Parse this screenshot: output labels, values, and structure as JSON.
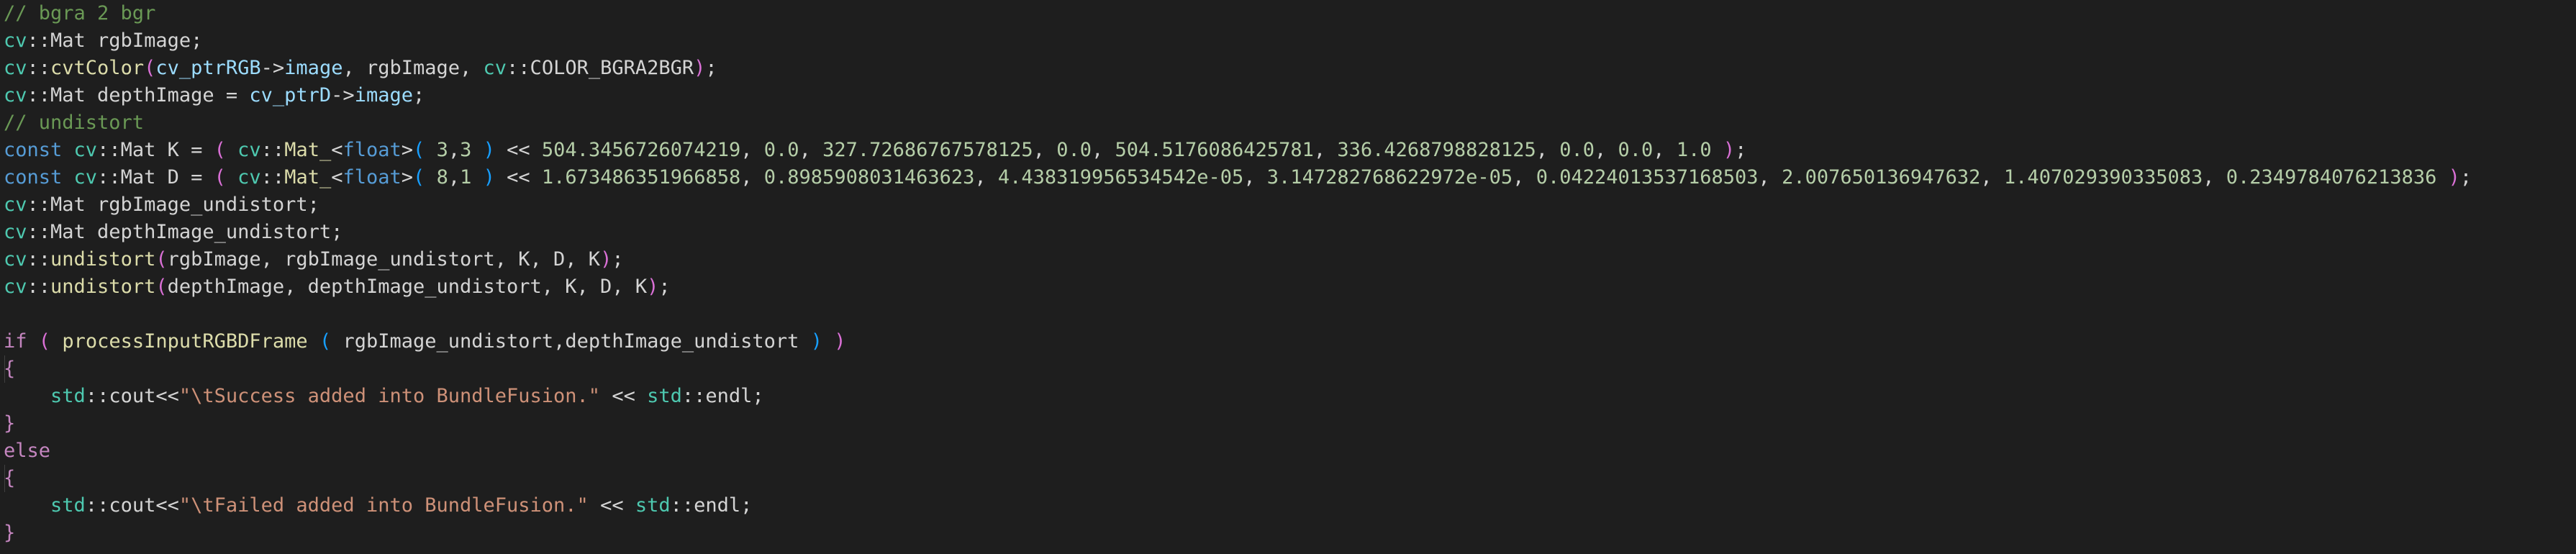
{
  "editor": {
    "lines": [
      [
        [
          "comment",
          "// bgra 2 bgr"
        ]
      ],
      [
        [
          "ns",
          "cv"
        ],
        [
          "plain",
          "::Mat rgbImage;"
        ]
      ],
      [
        [
          "ns",
          "cv"
        ],
        [
          "plain",
          "::"
        ],
        [
          "func",
          "cvtColor"
        ],
        [
          "paren1",
          "("
        ],
        [
          "ident",
          "cv_ptrRGB"
        ],
        [
          "plain",
          "->"
        ],
        [
          "ident",
          "image"
        ],
        [
          "plain",
          ", rgbImage, "
        ],
        [
          "ns",
          "cv"
        ],
        [
          "plain",
          "::COLOR_BGRA2BGR"
        ],
        [
          "paren1",
          ")"
        ],
        [
          "plain",
          ";"
        ]
      ],
      [
        [
          "ns",
          "cv"
        ],
        [
          "plain",
          "::Mat depthImage = "
        ],
        [
          "ident",
          "cv_ptrD"
        ],
        [
          "plain",
          "->"
        ],
        [
          "ident",
          "image"
        ],
        [
          "plain",
          ";"
        ]
      ],
      [
        [
          "comment",
          "// undistort"
        ]
      ],
      [
        [
          "keyword",
          "const"
        ],
        [
          "plain",
          " "
        ],
        [
          "ns",
          "cv"
        ],
        [
          "plain",
          "::Mat K = "
        ],
        [
          "paren1",
          "("
        ],
        [
          "plain",
          " "
        ],
        [
          "ns",
          "cv"
        ],
        [
          "plain",
          "::"
        ],
        [
          "func",
          "Mat_"
        ],
        [
          "plain",
          "<"
        ],
        [
          "keyword",
          "float"
        ],
        [
          "plain",
          ">"
        ],
        [
          "paren2",
          "("
        ],
        [
          "plain",
          " "
        ],
        [
          "number",
          "3"
        ],
        [
          "plain",
          ","
        ],
        [
          "number",
          "3"
        ],
        [
          "plain",
          " "
        ],
        [
          "paren2",
          ")"
        ],
        [
          "plain",
          " << "
        ],
        [
          "number",
          "504.3456726074219"
        ],
        [
          "plain",
          ", "
        ],
        [
          "number",
          "0.0"
        ],
        [
          "plain",
          ", "
        ],
        [
          "number",
          "327.72686767578125"
        ],
        [
          "plain",
          ", "
        ],
        [
          "number",
          "0.0"
        ],
        [
          "plain",
          ", "
        ],
        [
          "number",
          "504.5176086425781"
        ],
        [
          "plain",
          ", "
        ],
        [
          "number",
          "336.4268798828125"
        ],
        [
          "plain",
          ", "
        ],
        [
          "number",
          "0.0"
        ],
        [
          "plain",
          ", "
        ],
        [
          "number",
          "0.0"
        ],
        [
          "plain",
          ", "
        ],
        [
          "number",
          "1.0"
        ],
        [
          "plain",
          " "
        ],
        [
          "paren1",
          ")"
        ],
        [
          "plain",
          ";"
        ]
      ],
      [
        [
          "keyword",
          "const"
        ],
        [
          "plain",
          " "
        ],
        [
          "ns",
          "cv"
        ],
        [
          "plain",
          "::Mat D = "
        ],
        [
          "paren1",
          "("
        ],
        [
          "plain",
          " "
        ],
        [
          "ns",
          "cv"
        ],
        [
          "plain",
          "::"
        ],
        [
          "func",
          "Mat_"
        ],
        [
          "plain",
          "<"
        ],
        [
          "keyword",
          "float"
        ],
        [
          "plain",
          ">"
        ],
        [
          "paren2",
          "("
        ],
        [
          "plain",
          " "
        ],
        [
          "number",
          "8"
        ],
        [
          "plain",
          ","
        ],
        [
          "number",
          "1"
        ],
        [
          "plain",
          " "
        ],
        [
          "paren2",
          ")"
        ],
        [
          "plain",
          " << "
        ],
        [
          "number",
          "1.673486351966858"
        ],
        [
          "plain",
          ", "
        ],
        [
          "number",
          "0.8985908031463623"
        ],
        [
          "plain",
          ", "
        ],
        [
          "number",
          "4.438319956534542e-05"
        ],
        [
          "plain",
          ", "
        ],
        [
          "number",
          "3.147282768622972e-05"
        ],
        [
          "plain",
          ", "
        ],
        [
          "number",
          "0.04224013537168503"
        ],
        [
          "plain",
          ", "
        ],
        [
          "number",
          "2.007650136947632"
        ],
        [
          "plain",
          ", "
        ],
        [
          "number",
          "1.407029390335083"
        ],
        [
          "plain",
          ", "
        ],
        [
          "number",
          "0.2349784076213836"
        ],
        [
          "plain",
          " "
        ],
        [
          "paren1",
          ")"
        ],
        [
          "plain",
          ";"
        ]
      ],
      [
        [
          "ns",
          "cv"
        ],
        [
          "plain",
          "::Mat rgbImage_undistort;"
        ]
      ],
      [
        [
          "ns",
          "cv"
        ],
        [
          "plain",
          "::Mat depthImage_undistort;"
        ]
      ],
      [
        [
          "ns",
          "cv"
        ],
        [
          "plain",
          "::"
        ],
        [
          "func",
          "undistort"
        ],
        [
          "paren1",
          "("
        ],
        [
          "plain",
          "rgbImage, rgbImage_undistort, K, D, K"
        ],
        [
          "paren1",
          ")"
        ],
        [
          "plain",
          ";"
        ]
      ],
      [
        [
          "ns",
          "cv"
        ],
        [
          "plain",
          "::"
        ],
        [
          "func",
          "undistort"
        ],
        [
          "paren1",
          "("
        ],
        [
          "plain",
          "depthImage, depthImage_undistort, K, D, K"
        ],
        [
          "paren1",
          ")"
        ],
        [
          "plain",
          ";"
        ]
      ],
      [],
      [
        [
          "control",
          "if"
        ],
        [
          "plain",
          " "
        ],
        [
          "paren1",
          "("
        ],
        [
          "plain",
          " "
        ],
        [
          "func",
          "processInputRGBDFrame"
        ],
        [
          "plain",
          " "
        ],
        [
          "paren2",
          "("
        ],
        [
          "plain",
          " rgbImage_undistort,depthImage_undistort "
        ],
        [
          "paren2",
          ")"
        ],
        [
          "plain",
          " "
        ],
        [
          "paren1",
          ")"
        ]
      ],
      [
        [
          "brace",
          "{"
        ]
      ],
      [
        [
          "plain",
          "    "
        ],
        [
          "ns",
          "std"
        ],
        [
          "plain",
          "::cout<<"
        ],
        [
          "string",
          "\"\\tSuccess added into BundleFusion.\""
        ],
        [
          "plain",
          " << "
        ],
        [
          "ns",
          "std"
        ],
        [
          "plain",
          "::endl;"
        ]
      ],
      [
        [
          "brace",
          "}"
        ]
      ],
      [
        [
          "control",
          "else"
        ]
      ],
      [
        [
          "brace",
          "{"
        ]
      ],
      [
        [
          "plain",
          "    "
        ],
        [
          "ns",
          "std"
        ],
        [
          "plain",
          "::cout<<"
        ],
        [
          "string",
          "\"\\tFailed added into BundleFusion.\""
        ],
        [
          "plain",
          " << "
        ],
        [
          "ns",
          "std"
        ],
        [
          "plain",
          "::endl;"
        ]
      ],
      [
        [
          "brace",
          "}"
        ]
      ]
    ],
    "guide_lines": [
      13,
      17
    ],
    "colors": {
      "background": "#1e1e1e",
      "comment": "#6a9955",
      "keyword": "#569cd6",
      "namespace": "#4ec9b0",
      "function": "#dcdcaa",
      "identifier": "#9cdcfe",
      "number": "#b5cea8",
      "string": "#ce9178",
      "control": "#c586c0"
    }
  }
}
